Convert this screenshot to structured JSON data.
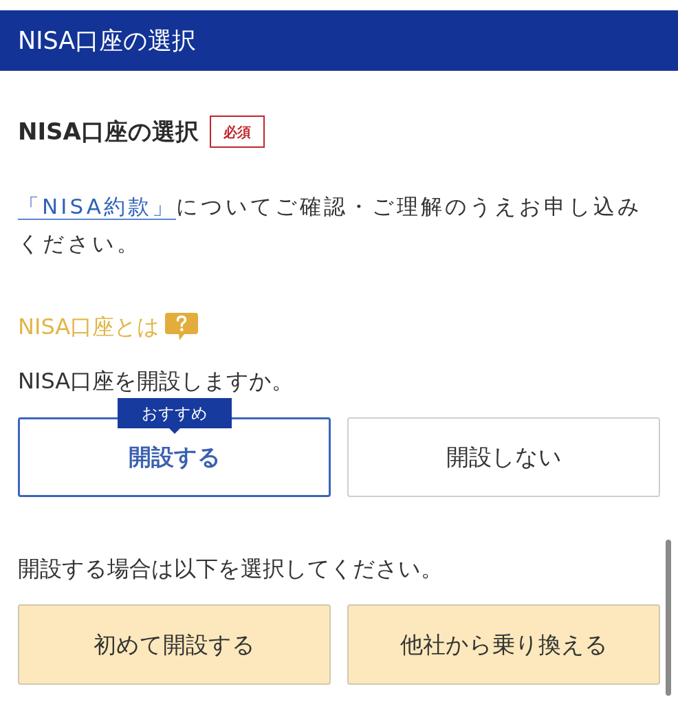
{
  "header": {
    "title": "NISA口座の選択"
  },
  "section": {
    "title": "NISA口座の選択",
    "required_badge": "必須"
  },
  "notice": {
    "link": "「NISA約款」",
    "text": "についてご確認・ご理解のうえお申し込みください。"
  },
  "help_link": {
    "label": "NISA口座とは"
  },
  "question": {
    "label": "NISA口座を開設しますか。",
    "options": [
      {
        "label": "開設する",
        "selected": true,
        "recommended_tag": "おすすめ"
      },
      {
        "label": "開設しない",
        "selected": false
      }
    ]
  },
  "sub_question": {
    "label": "開設する場合は以下を選択してください。",
    "options": [
      {
        "label": "初めて開設する",
        "selected": false
      },
      {
        "label": "他社から乗り換える",
        "selected": false
      }
    ]
  }
}
